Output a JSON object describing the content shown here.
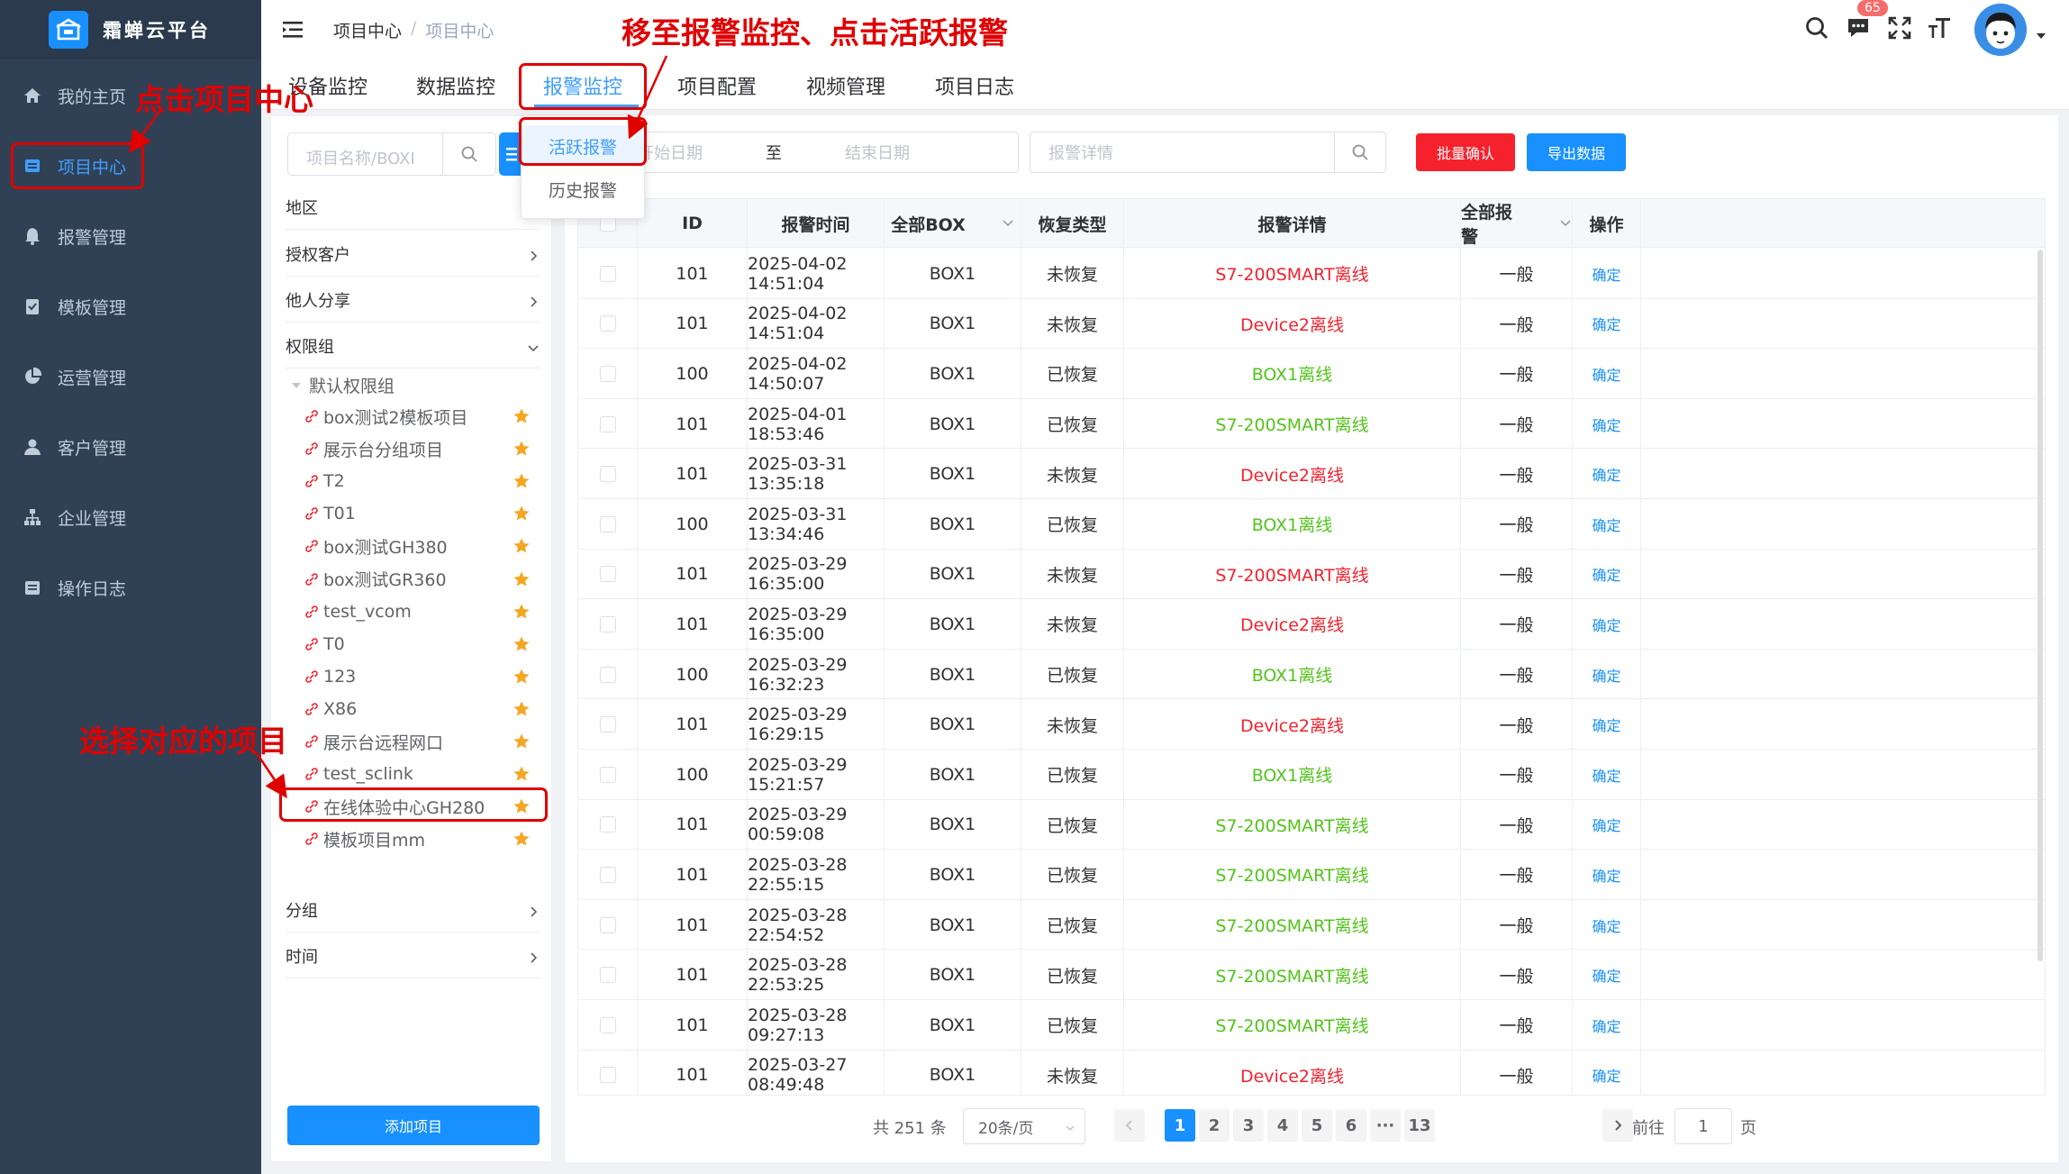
{
  "app": {
    "title": "霜蝉云平台"
  },
  "sidebar": {
    "items": [
      {
        "label": "我的主页",
        "icon": "home-icon"
      },
      {
        "label": "项目中心",
        "icon": "project-icon",
        "active": true
      },
      {
        "label": "报警管理",
        "icon": "bell-icon"
      },
      {
        "label": "模板管理",
        "icon": "template-icon"
      },
      {
        "label": "运营管理",
        "icon": "pie-chart-icon"
      },
      {
        "label": "客户管理",
        "icon": "user-icon"
      },
      {
        "label": "企业管理",
        "icon": "org-icon"
      },
      {
        "label": "操作日志",
        "icon": "log-icon"
      }
    ]
  },
  "breadcrumb": {
    "root": "项目中心",
    "separator": "/",
    "current": "项目中心"
  },
  "header": {
    "message_badge": "65",
    "icons": [
      "search-icon",
      "message-icon",
      "fullscreen-icon",
      "font-size-icon",
      "avatar",
      "caret-down-icon"
    ]
  },
  "tabs": [
    {
      "label": "设备监控"
    },
    {
      "label": "数据监控"
    },
    {
      "label": "报警监控",
      "active": true
    },
    {
      "label": "项目配置"
    },
    {
      "label": "视频管理"
    },
    {
      "label": "项目日志"
    }
  ],
  "dropdown": {
    "items": [
      {
        "label": "活跃报警",
        "active": true
      },
      {
        "label": "历史报警"
      }
    ]
  },
  "tree": {
    "search_placeholder": "项目名称/BOXI",
    "sections": [
      {
        "label": "地区",
        "expanded": false
      },
      {
        "label": "授权客户",
        "expanded": false
      },
      {
        "label": "他人分享",
        "expanded": false
      },
      {
        "label": "权限组",
        "expanded": true
      }
    ],
    "group_label": "默认权限组",
    "projects": [
      "box测试2模板项目",
      "展示台分组项目",
      "T2",
      "T01",
      "box测试GH380",
      "box测试GR360",
      "test_vcom",
      "T0",
      "123",
      "X86",
      "展示台远程网口",
      "test_sclink",
      "在线体验中心GH280",
      "模板项目mm"
    ],
    "bottom_sections": [
      {
        "label": "分组"
      },
      {
        "label": "时间"
      }
    ],
    "add_button": "添加项目"
  },
  "filters": {
    "start_date_placeholder": "开始日期",
    "range_separator": "至",
    "end_date_placeholder": "结束日期",
    "detail_placeholder": "报警详情",
    "batch_confirm": "批量确认",
    "export": "导出数据"
  },
  "colors": {
    "primary": "#1890ff",
    "danger": "#f5222d",
    "success": "#52c41a",
    "annotation": "#e00000"
  },
  "table": {
    "headers": [
      "ID",
      "报警时间",
      "全部BOX",
      "恢复类型",
      "报警详情",
      "全部报警",
      "操作"
    ],
    "rows": [
      {
        "id": "101",
        "time": "2025-04-02 14:51:04",
        "box": "BOX1",
        "recovery": "未恢复",
        "detail": "S7-200SMART离线",
        "level": "一般",
        "action": "确定"
      },
      {
        "id": "101",
        "time": "2025-04-02 14:51:04",
        "box": "BOX1",
        "recovery": "未恢复",
        "detail": "Device2离线",
        "level": "一般",
        "action": "确定"
      },
      {
        "id": "100",
        "time": "2025-04-02 14:50:07",
        "box": "BOX1",
        "recovery": "已恢复",
        "detail": "BOX1离线",
        "level": "一般",
        "action": "确定"
      },
      {
        "id": "101",
        "time": "2025-04-01 18:53:46",
        "box": "BOX1",
        "recovery": "已恢复",
        "detail": "S7-200SMART离线",
        "level": "一般",
        "action": "确定"
      },
      {
        "id": "101",
        "time": "2025-03-31 13:35:18",
        "box": "BOX1",
        "recovery": "未恢复",
        "detail": "Device2离线",
        "level": "一般",
        "action": "确定"
      },
      {
        "id": "100",
        "time": "2025-03-31 13:34:46",
        "box": "BOX1",
        "recovery": "已恢复",
        "detail": "BOX1离线",
        "level": "一般",
        "action": "确定"
      },
      {
        "id": "101",
        "time": "2025-03-29 16:35:00",
        "box": "BOX1",
        "recovery": "未恢复",
        "detail": "S7-200SMART离线",
        "level": "一般",
        "action": "确定"
      },
      {
        "id": "101",
        "time": "2025-03-29 16:35:00",
        "box": "BOX1",
        "recovery": "未恢复",
        "detail": "Device2离线",
        "level": "一般",
        "action": "确定"
      },
      {
        "id": "100",
        "time": "2025-03-29 16:32:23",
        "box": "BOX1",
        "recovery": "已恢复",
        "detail": "BOX1离线",
        "level": "一般",
        "action": "确定"
      },
      {
        "id": "101",
        "time": "2025-03-29 16:29:15",
        "box": "BOX1",
        "recovery": "未恢复",
        "detail": "Device2离线",
        "level": "一般",
        "action": "确定"
      },
      {
        "id": "100",
        "time": "2025-03-29 15:21:57",
        "box": "BOX1",
        "recovery": "已恢复",
        "detail": "BOX1离线",
        "level": "一般",
        "action": "确定"
      },
      {
        "id": "101",
        "time": "2025-03-29 00:59:08",
        "box": "BOX1",
        "recovery": "已恢复",
        "detail": "S7-200SMART离线",
        "level": "一般",
        "action": "确定"
      },
      {
        "id": "101",
        "time": "2025-03-28 22:55:15",
        "box": "BOX1",
        "recovery": "已恢复",
        "detail": "S7-200SMART离线",
        "level": "一般",
        "action": "确定"
      },
      {
        "id": "101",
        "time": "2025-03-28 22:54:52",
        "box": "BOX1",
        "recovery": "已恢复",
        "detail": "S7-200SMART离线",
        "level": "一般",
        "action": "确定"
      },
      {
        "id": "101",
        "time": "2025-03-28 22:53:25",
        "box": "BOX1",
        "recovery": "已恢复",
        "detail": "S7-200SMART离线",
        "level": "一般",
        "action": "确定"
      },
      {
        "id": "101",
        "time": "2025-03-28 09:27:13",
        "box": "BOX1",
        "recovery": "已恢复",
        "detail": "S7-200SMART离线",
        "level": "一般",
        "action": "确定"
      },
      {
        "id": "101",
        "time": "2025-03-27 08:49:48",
        "box": "BOX1",
        "recovery": "未恢复",
        "detail": "Device2离线",
        "level": "一般",
        "action": "确定"
      }
    ]
  },
  "pagination": {
    "total": "共 251 条",
    "page_size": "20条/页",
    "pages": [
      "1",
      "2",
      "3",
      "4",
      "5",
      "6",
      "···",
      "13"
    ],
    "current": "1",
    "goto_label": "前往",
    "goto_value": "1",
    "goto_suffix": "页"
  },
  "annotations": {
    "top": "移至报警监控、点击活跃报警",
    "click_project": "点击项目中心",
    "select_project": "选择对应的项目"
  }
}
